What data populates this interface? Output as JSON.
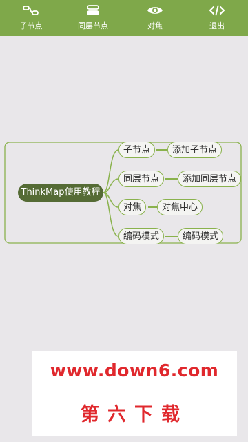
{
  "toolbar": {
    "items": [
      {
        "label": "子节点",
        "icon": "child-node-icon"
      },
      {
        "label": "同层节点",
        "icon": "sibling-node-icon"
      },
      {
        "label": "对焦",
        "icon": "eye-icon"
      },
      {
        "label": "退出",
        "icon": "code-icon"
      }
    ],
    "color": "#7fa84a"
  },
  "mindmap": {
    "root": "ThinkMap使用教程",
    "branches": [
      {
        "label": "子节点",
        "child": "添加子节点"
      },
      {
        "label": "同层节点",
        "child": "添加同层节点"
      },
      {
        "label": "对焦",
        "child": "对焦中心"
      },
      {
        "label": "编码模式",
        "child": "编码模式"
      }
    ],
    "line_color": "#8ab24d",
    "root_color": "#556b35"
  },
  "watermark": {
    "url": "www.down6.com",
    "text": "第六下载",
    "color": "#e0282d"
  }
}
